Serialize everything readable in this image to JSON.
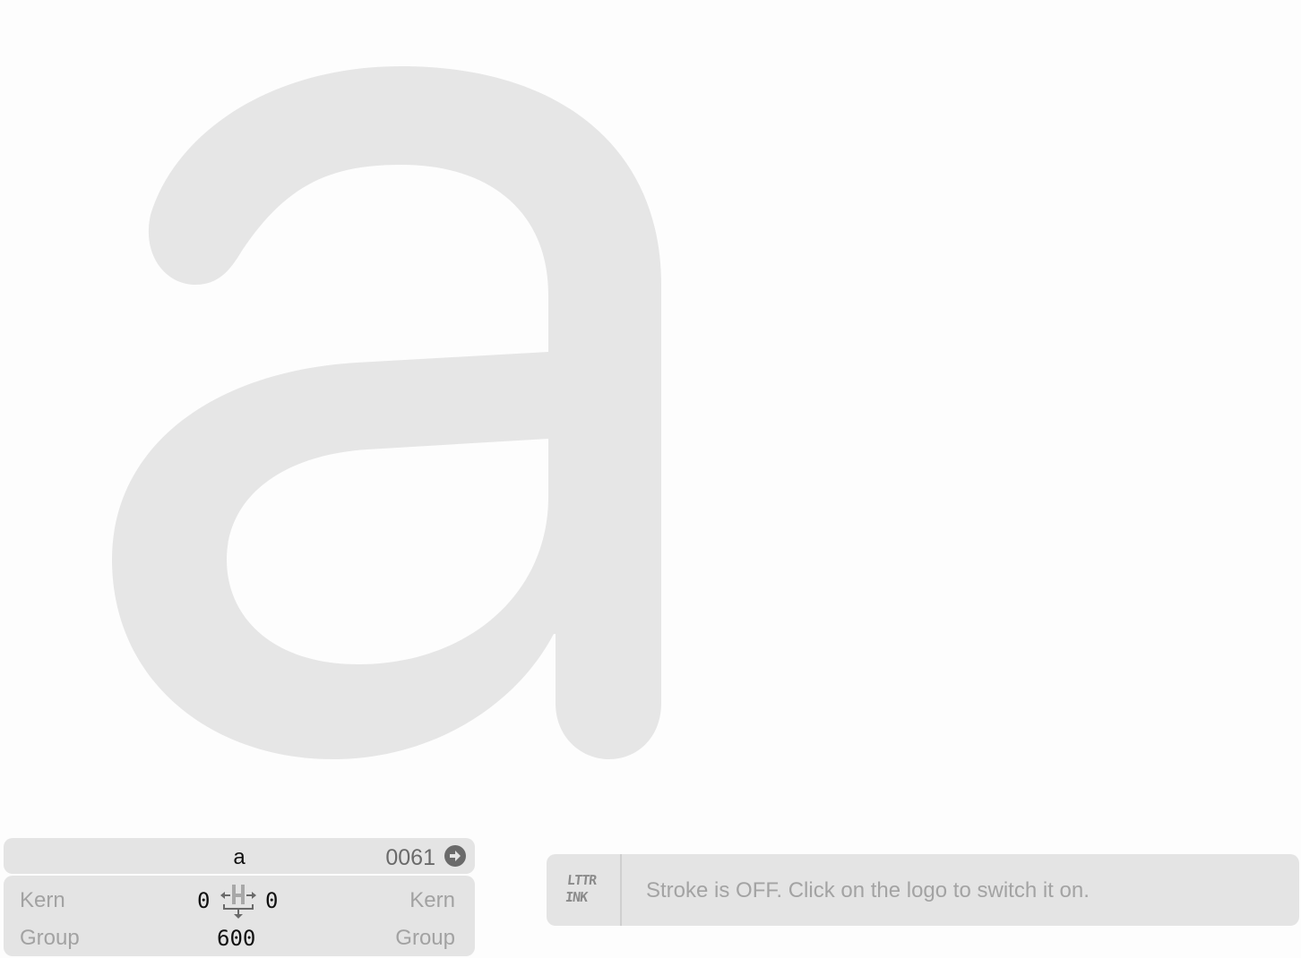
{
  "glyph": {
    "character": "a",
    "unicode": "0061",
    "nav_icon": "arrow-right-circle-icon"
  },
  "metrics": {
    "left_kern_label": "Kern",
    "right_kern_label": "Kern",
    "left_group_label": "Group",
    "right_group_label": "Group",
    "left_sidebearing": "0",
    "right_sidebearing": "0",
    "advance_width": "600",
    "sidebearing_icon": "sidebearing-width-icon"
  },
  "stroke_bar": {
    "logo_text_line1": "LTTR",
    "logo_text_line2": "INK",
    "message": "Stroke is OFF. Click on the logo to switch it on."
  },
  "colors": {
    "glyph_fill": "#e6e6e6",
    "panel_bg": "#e4e4e4",
    "muted_text": "#a3a3a3",
    "icon_gray": "#6a6a6a"
  }
}
